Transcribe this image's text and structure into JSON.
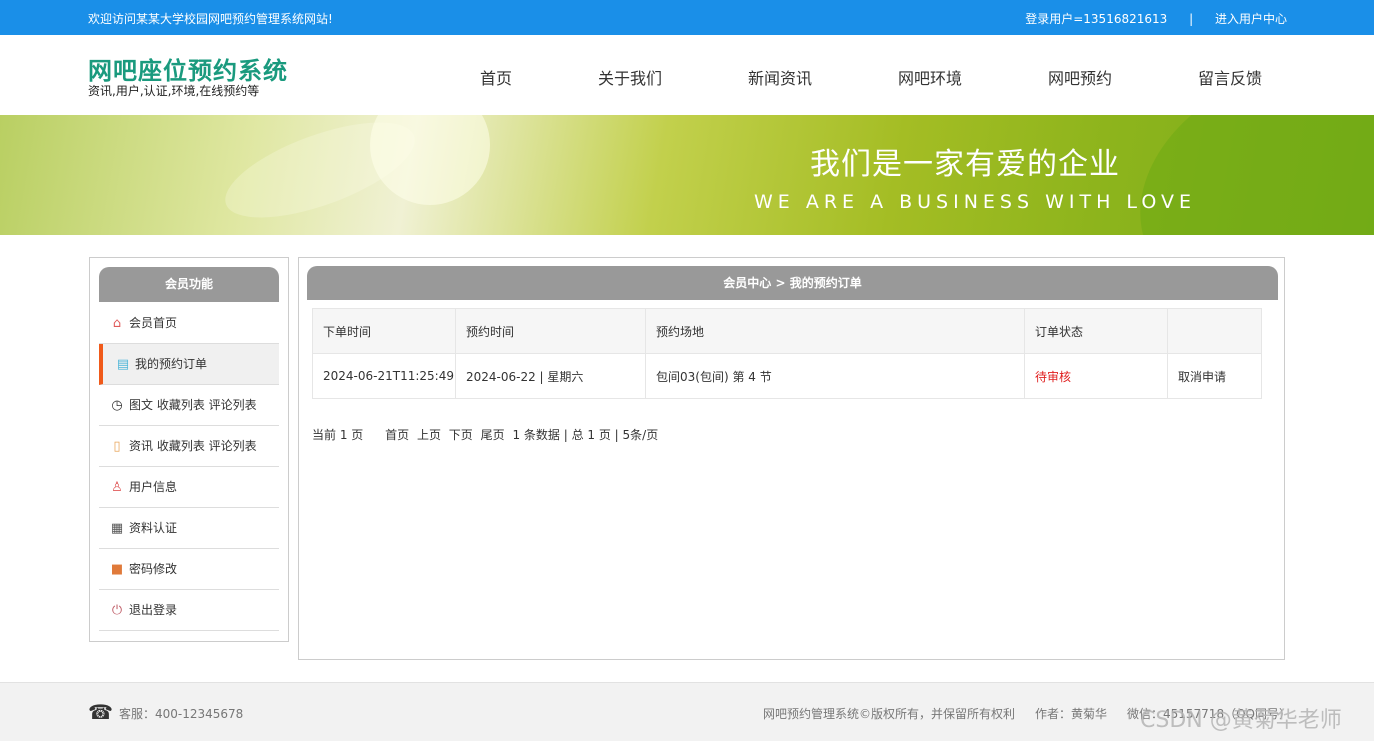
{
  "topbar": {
    "welcome": "欢迎访问某某大学校园网吧预约管理系统网站!",
    "login_user": "登录用户=13516821613",
    "separator": "|",
    "user_center": "进入用户中心"
  },
  "header": {
    "title": "网吧座位预约系统",
    "subtitle": "资讯,用户,认证,环境,在线预约等"
  },
  "nav": [
    "首页",
    "关于我们",
    "新闻资讯",
    "网吧环境",
    "网吧预约",
    "留言反馈"
  ],
  "banner": {
    "cn_slogan": "我们是一家有爱的企业",
    "en_slogan": "WE ARE A BUSINESS WITH LOVE"
  },
  "sidebar": {
    "title": "会员功能",
    "items": [
      {
        "label": "会员首页",
        "icon": "home-icon"
      },
      {
        "label": "我的预约订单",
        "icon": "clipboard-icon",
        "active": true
      },
      {
        "label": "图文 收藏列表 评论列表",
        "icon": "clock-icon"
      },
      {
        "label": "资讯 收藏列表 评论列表",
        "icon": "document-icon"
      },
      {
        "label": "用户信息",
        "icon": "user-icon"
      },
      {
        "label": "资料认证",
        "icon": "grid-icon"
      },
      {
        "label": "密码修改",
        "icon": "lock-icon"
      },
      {
        "label": "退出登录",
        "icon": "power-icon"
      }
    ]
  },
  "main": {
    "breadcrumb": "会员中心 > 我的预约订单",
    "columns": [
      "下单时间",
      "预约时间",
      "预约场地",
      "订单状态",
      ""
    ],
    "rows": [
      {
        "order_time": "2024-06-21T11:25:49",
        "booking_time": "2024-06-22 | 星期六",
        "venue": "包间03(包间) 第 4 节",
        "status": "待审核",
        "action": "取消申请"
      }
    ],
    "pager": {
      "current": "当前 1 页",
      "links": [
        "首页",
        "上页",
        "下页",
        "尾页"
      ],
      "summary": "1 条数据 | 总 1 页 | 5条/页"
    }
  },
  "footer": {
    "service": "客服：400-12345678",
    "copyright": "网吧预约管理系统©版权所有，并保留所有权利",
    "author": "作者：黄菊华",
    "wechat": "微信：45157718（QQ同号）"
  },
  "watermark": "CSDN @黄菊华老师",
  "colors": {
    "topbar": "#1a8fe8",
    "logo": "#1a9a7e",
    "panel_head": "#999999",
    "active_border": "#f05a1a",
    "pending": "#e02020"
  }
}
